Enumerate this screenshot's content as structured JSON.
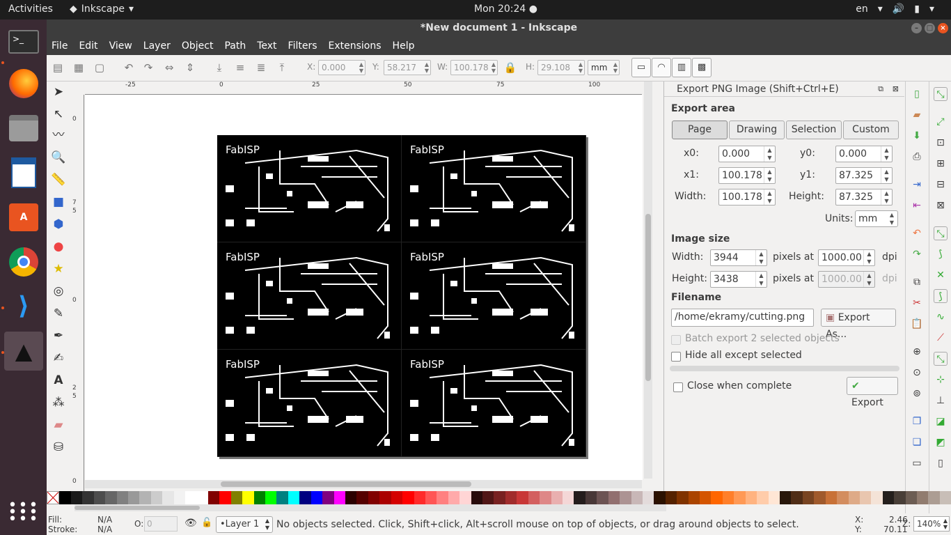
{
  "topbar": {
    "activities": "Activities",
    "app_name": "Inkscape",
    "clock": "Mon 20:24",
    "lang": "en"
  },
  "window": {
    "title": "*New document 1 - Inkscape"
  },
  "menu": [
    "File",
    "Edit",
    "View",
    "Layer",
    "Object",
    "Path",
    "Text",
    "Filters",
    "Extensions",
    "Help"
  ],
  "toolbar": {
    "x_label": "X:",
    "x": "0.000",
    "y_label": "Y:",
    "y": "58.217",
    "w_label": "W:",
    "w": "100.178",
    "h_label": "H:",
    "h": "29.108",
    "unit": "mm"
  },
  "ruler": {
    "h": [
      "-25",
      "0",
      "25",
      "50",
      "75",
      "100"
    ],
    "v": [
      "0",
      "7",
      "5",
      "0",
      "2",
      "5",
      "0"
    ]
  },
  "boards": [
    {
      "label": "FabISP"
    },
    {
      "label": "FabISP"
    },
    {
      "label": "FabISP"
    },
    {
      "label": "FabISP"
    },
    {
      "label": "FabISP"
    },
    {
      "label": "FabISP"
    }
  ],
  "export": {
    "title": "Export PNG Image (Shift+Ctrl+E)",
    "area_heading": "Export area",
    "tabs": [
      "Page",
      "Drawing",
      "Selection",
      "Custom"
    ],
    "x0_label": "x0:",
    "x0": "0.000",
    "y0_label": "y0:",
    "y0": "0.000",
    "x1_label": "x1:",
    "x1": "100.178",
    "y1_label": "y1:",
    "y1": "87.325",
    "width_label": "Width:",
    "width": "100.178",
    "height_label": "Height:",
    "height": "87.325",
    "units_label": "Units:",
    "units": "mm",
    "image_heading": "Image size",
    "img_width_label": "Width:",
    "img_width": "3944",
    "pixels_at": "pixels at",
    "dpi_value": "1000.00",
    "dpi": "dpi",
    "img_height_label": "Height:",
    "img_height": "3438",
    "dpi_value2": "1000.00",
    "filename_heading": "Filename",
    "filename": "/home/ekramy/cutting.png",
    "export_as": "Export As...",
    "batch": "Batch export 2 selected objects",
    "hide": "Hide all except selected",
    "close_when": "Close when complete",
    "export_btn": "Export"
  },
  "status": {
    "fill_label": "Fill:",
    "fill": "N/A",
    "stroke_label": "Stroke:",
    "stroke": "N/A",
    "opacity_label": "O:",
    "opacity": "0",
    "layer": "•Layer 1",
    "message": "No objects selected. Click, Shift+click, Alt+scroll mouse on top of objects, or drag around objects to select.",
    "x_label": "X:",
    "x": "2.46",
    "y_label": "Y:",
    "y": "70.11",
    "z_label": "Z:",
    "zoom": "140%"
  },
  "palette": [
    "#000000",
    "#1a1a1a",
    "#333333",
    "#4d4d4d",
    "#666666",
    "#808080",
    "#999999",
    "#b3b3b3",
    "#cccccc",
    "#e6e6e6",
    "#f2f2f2",
    "#ffffff",
    "#ffffff",
    "#800000",
    "#ff0000",
    "#808000",
    "#ffff00",
    "#008000",
    "#00ff00",
    "#008080",
    "#00ffff",
    "#000080",
    "#0000ff",
    "#800080",
    "#ff00ff",
    "#2b0000",
    "#550000",
    "#800000",
    "#aa0000",
    "#d40000",
    "#ff0000",
    "#ff2a2a",
    "#ff5555",
    "#ff8080",
    "#ffaaaa",
    "#ffd5d5",
    "#280b0b",
    "#501616",
    "#782121",
    "#a02c2c",
    "#c83737",
    "#d35f5f",
    "#de8787",
    "#e9afaf",
    "#f4d7d7",
    "#241c1c",
    "#483737",
    "#6c5353",
    "#916f6f",
    "#ac9393",
    "#c8b7b7",
    "#e3dbdb",
    "#2b1100",
    "#552200",
    "#803300",
    "#aa4400",
    "#d45500",
    "#ff6600",
    "#ff7f2a",
    "#ff9955",
    "#ffb380",
    "#ffccaa",
    "#ffe6d5",
    "#28170b",
    "#502d16",
    "#784421",
    "#a05a2c",
    "#c87137",
    "#d38d5f",
    "#deaa87",
    "#e9c6af",
    "#f4e3d7",
    "#241f1c",
    "#483e37",
    "#6c5d53",
    "#917c6f",
    "#ac9d93",
    "#c8beb7"
  ]
}
